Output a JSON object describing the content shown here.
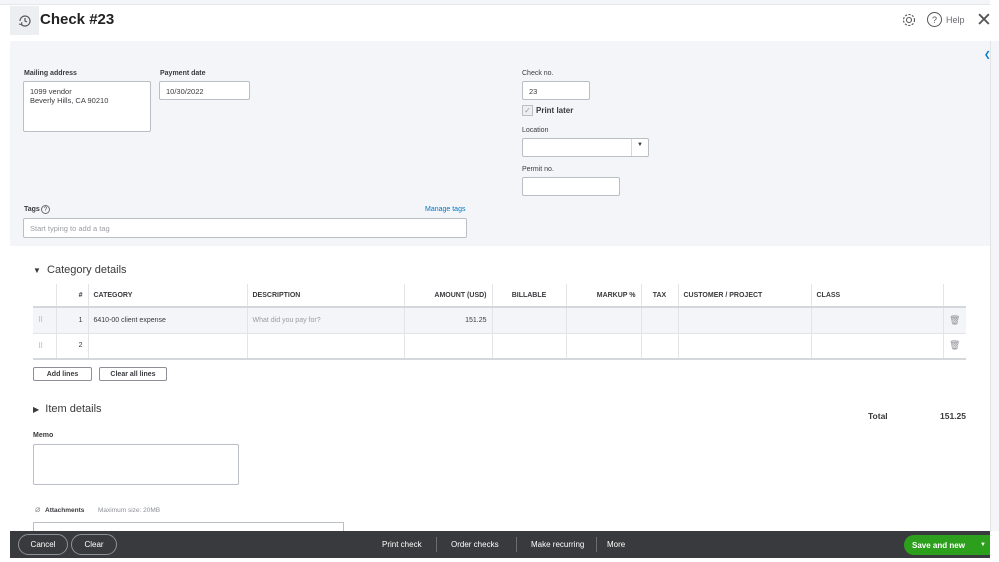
{
  "header": {
    "title": "Check #23",
    "help": "Help"
  },
  "form": {
    "mailing_address_label": "Mailing address",
    "mailing_address_line1": "1099 vendor",
    "mailing_address_line2": "Beverly Hills, CA  90210",
    "payment_date_label": "Payment date",
    "payment_date": "10/30/2022",
    "check_no_label": "Check no.",
    "check_no": "23",
    "print_later_label": "Print later",
    "print_later_checked": true,
    "location_label": "Location",
    "location": "",
    "permit_no_label": "Permit no.",
    "permit_no": "",
    "tags_label": "Tags",
    "manage_tags": "Manage tags",
    "tags_placeholder": "Start typing to add a tag"
  },
  "category": {
    "title": "Category details",
    "columns": [
      "#",
      "CATEGORY",
      "DESCRIPTION",
      "AMOUNT (USD)",
      "BILLABLE",
      "MARKUP %",
      "TAX",
      "CUSTOMER / PROJECT",
      "CLASS"
    ],
    "rows": [
      {
        "num": "1",
        "category": "6410-00 client expense",
        "description_placeholder": "What did you pay for?",
        "amount": "151.25"
      },
      {
        "num": "2",
        "category": "",
        "description_placeholder": "",
        "amount": ""
      }
    ],
    "add_lines": "Add lines",
    "clear_all_lines": "Clear all lines"
  },
  "item_details": "Item details",
  "total_label": "Total",
  "total": "151.25",
  "memo_label": "Memo",
  "attachments_label": "Attachments",
  "attachments_max": "Maximum size: 20MB",
  "footer": {
    "cancel": "Cancel",
    "clear": "Clear",
    "print_check": "Print check",
    "order_checks": "Order checks",
    "make_recurring": "Make recurring",
    "more": "More",
    "save_and_new": "Save and new"
  },
  "colors": {
    "accent_green": "#2ca01c",
    "link_blue": "#0077c5",
    "footer_bg": "#393a3d"
  }
}
